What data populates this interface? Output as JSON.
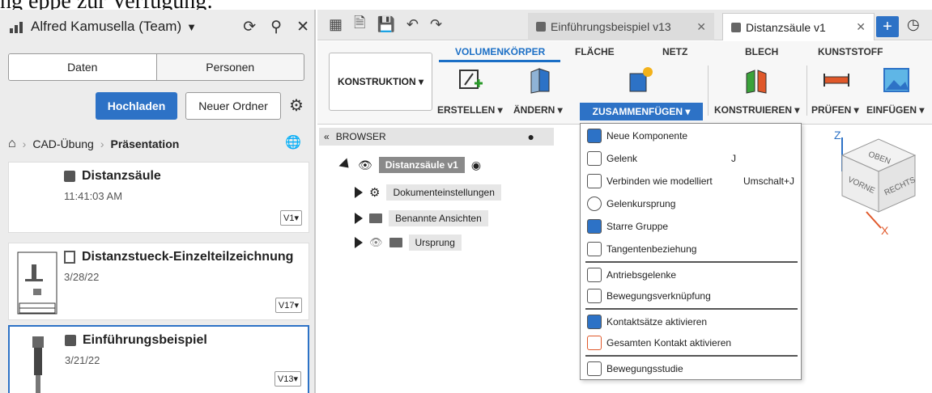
{
  "caption": "ng eppe zur Verfügung:",
  "left_panel": {
    "team": "Alfred Kamusella (Team)",
    "segments": [
      "Daten",
      "Personen"
    ],
    "upload_label": "Hochladen",
    "new_folder_label": "Neuer Ordner",
    "breadcrumb": [
      "CAD-Übung",
      "Präsentation"
    ],
    "items": [
      {
        "title": "Distanzsäule",
        "date": "11:41:03 AM",
        "version": "V1▾"
      },
      {
        "title": "Distanzstueck-Einzelteilzeichnung",
        "date": "3/28/22",
        "version": "V17▾"
      },
      {
        "title": "Einführungsbeispiel",
        "date": "3/21/22",
        "version": "V13▾"
      }
    ]
  },
  "tabs": [
    {
      "label": "Einführungsbeispiel v13"
    },
    {
      "label": "Distanzsäule v1"
    }
  ],
  "ribbon": {
    "tabs": [
      "VOLUMENKÖRPER",
      "FLÄCHE",
      "NETZ",
      "BLECH",
      "KUNSTSTOFF"
    ],
    "workspace": "KONSTRUKTION ▾",
    "groups": [
      "ERSTELLEN ▾",
      "ÄNDERN ▾",
      "ZUSAMMENFÜGEN ▾",
      "KONSTRUIEREN ▾",
      "PRÜFEN ▾",
      "EINFÜGEN ▾"
    ]
  },
  "browser": {
    "title": "BROWSER",
    "root": "Distanzsäule v1",
    "children": [
      "Dokumenteinstellungen",
      "Benannte Ansichten",
      "Ursprung"
    ]
  },
  "menu": {
    "items": [
      {
        "label": "Neue Komponente",
        "shortcut": ""
      },
      {
        "label": "Gelenk",
        "shortcut": "J"
      },
      {
        "label": "Verbinden wie modelliert",
        "shortcut": "Umschalt+J"
      },
      {
        "label": "Gelenkursprung",
        "shortcut": ""
      },
      {
        "label": "Starre Gruppe",
        "shortcut": ""
      },
      {
        "label": "Tangentenbeziehung",
        "shortcut": ""
      },
      {
        "label": "Antriebsgelenke",
        "shortcut": ""
      },
      {
        "label": "Bewegungsverknüpfung",
        "shortcut": ""
      },
      {
        "label": "Kontaktsätze aktivieren",
        "shortcut": ""
      },
      {
        "label": "Gesamten Kontakt aktivieren",
        "shortcut": ""
      },
      {
        "label": "Bewegungsstudie",
        "shortcut": ""
      }
    ]
  },
  "viewcube": {
    "top": "OBEN",
    "front": "VORNE",
    "right": "RECHTS",
    "axis_z": "Z",
    "axis_x": "X"
  },
  "colors": {
    "accent": "#2d72c6",
    "active_tab_text": "#1b6fc6"
  }
}
